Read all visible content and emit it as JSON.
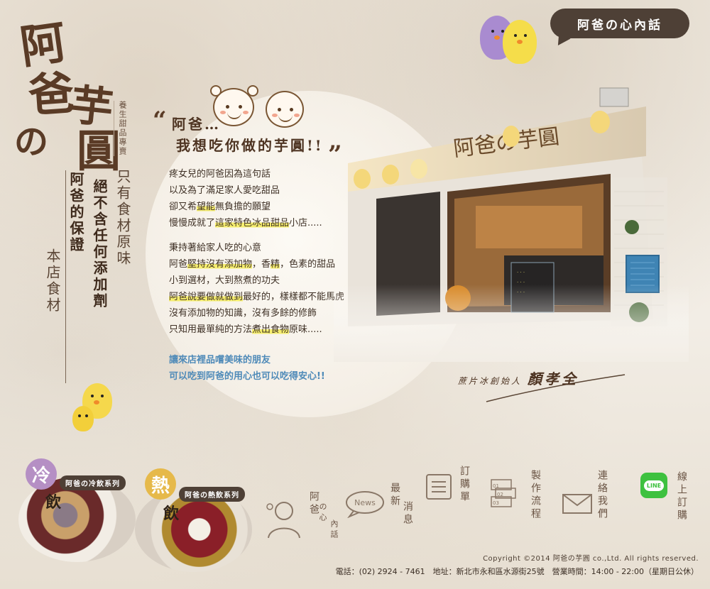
{
  "logo": {
    "chars": [
      "阿",
      "爸",
      "の",
      "芋",
      "圓"
    ],
    "tagline": "養生甜品專賣"
  },
  "slogan": {
    "col1": "只有食材原味",
    "col2": "絕不含任何添加劑",
    "col3": "阿爸的保證",
    "col4": "本店食材"
  },
  "header": {
    "bubble_label": "阿爸の心內話"
  },
  "story": {
    "quote_open": "“",
    "quote_close": "”",
    "headline_line1": "阿爸…",
    "headline_line2": "我想吃你做的芋圓!!",
    "para1": {
      "l1": "疼女兒的阿爸因為這句話",
      "l2": "以及為了滿足家人愛吃甜品",
      "l3a": "卻又希",
      "l3b": "望能",
      "l3c": "無負擔的願望",
      "l4a": "慢慢成就了",
      "l4b": "這家特色冰品甜品",
      "l4c": "小店....."
    },
    "para2": {
      "l1": "秉持著給家人吃的心意",
      "l2a": "阿爸",
      "l2b": "堅持沒有添加物",
      "l2c": "，香",
      "l2d": "精",
      "l2e": "，色素的甜品",
      "l3": "小到選材，大到熬煮的功夫",
      "l4a": "阿爸說要做就做到",
      "l4b": "最好的，樣樣都不能馬虎",
      "l5": "沒有添加物的知識，沒有多餘的修飾",
      "l6a": "只知用最單純的方法",
      "l6b": "煮出食物",
      "l6c": "原味....."
    },
    "blue1": "讓來店裡品嚐美味的朋友",
    "blue2": "可以吃到阿爸的用心也可以吃得安心!!"
  },
  "signature": {
    "role": "蔗片冰創始人",
    "name": "顏孝全"
  },
  "drinks": {
    "cold": {
      "badge": "冷",
      "char": "飲",
      "label": "阿爸の冷飲系列"
    },
    "hot": {
      "badge": "熱",
      "char": "飲",
      "label": "阿爸の熱飲系列"
    }
  },
  "nav": {
    "heart_talk": {
      "c1": "阿爸",
      "c2": "の心",
      "c3": "內話"
    },
    "news": {
      "icon_text": "News",
      "c1": "最新",
      "c2": "消息"
    },
    "order": {
      "c1": "訂購單"
    },
    "process": {
      "c1": "製作流程"
    },
    "contact": {
      "c1": "連絡我們"
    },
    "line": {
      "icon_text": "LINE",
      "c1": "線上訂購"
    }
  },
  "footer": {
    "copyright": "Copyright ©2014 阿爸の芋圓 co.,Ltd. All rights reserved.",
    "info": "電話：(02) 2924 - 7461　地址：新北市永和區水源街25號　營業時間：14:00 - 22:00（星期日公休）"
  },
  "colors": {
    "brown": "#4e4036",
    "cold_badge": "#b58fc4",
    "hot_badge": "#e6b94a",
    "highlight": "#f6ee6e",
    "blue_text": "#4e8ab8",
    "line_green": "#3ec13f"
  }
}
